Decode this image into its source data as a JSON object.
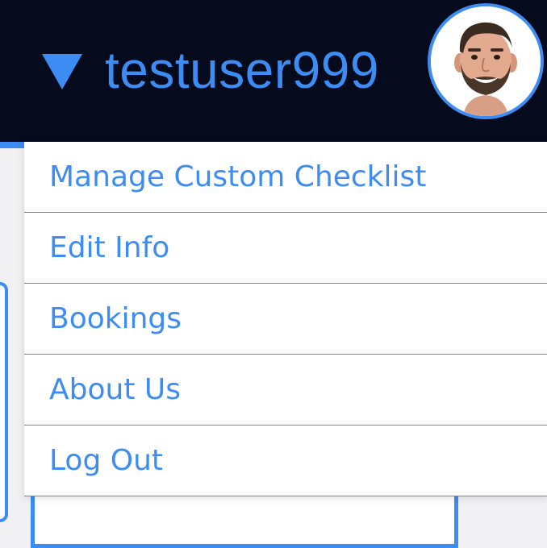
{
  "header": {
    "username": "testuser999",
    "caret_icon": "caret-down-icon",
    "avatar_icon": "user-avatar-photo"
  },
  "menu": {
    "items": [
      {
        "label": "Manage Custom Checklist"
      },
      {
        "label": "Edit Info"
      },
      {
        "label": "Bookings"
      },
      {
        "label": "About Us"
      },
      {
        "label": "Log Out"
      }
    ]
  },
  "colors": {
    "accent": "#3d8cf4",
    "topbar_bg": "#050a1c",
    "menu_bg": "#ffffff"
  }
}
